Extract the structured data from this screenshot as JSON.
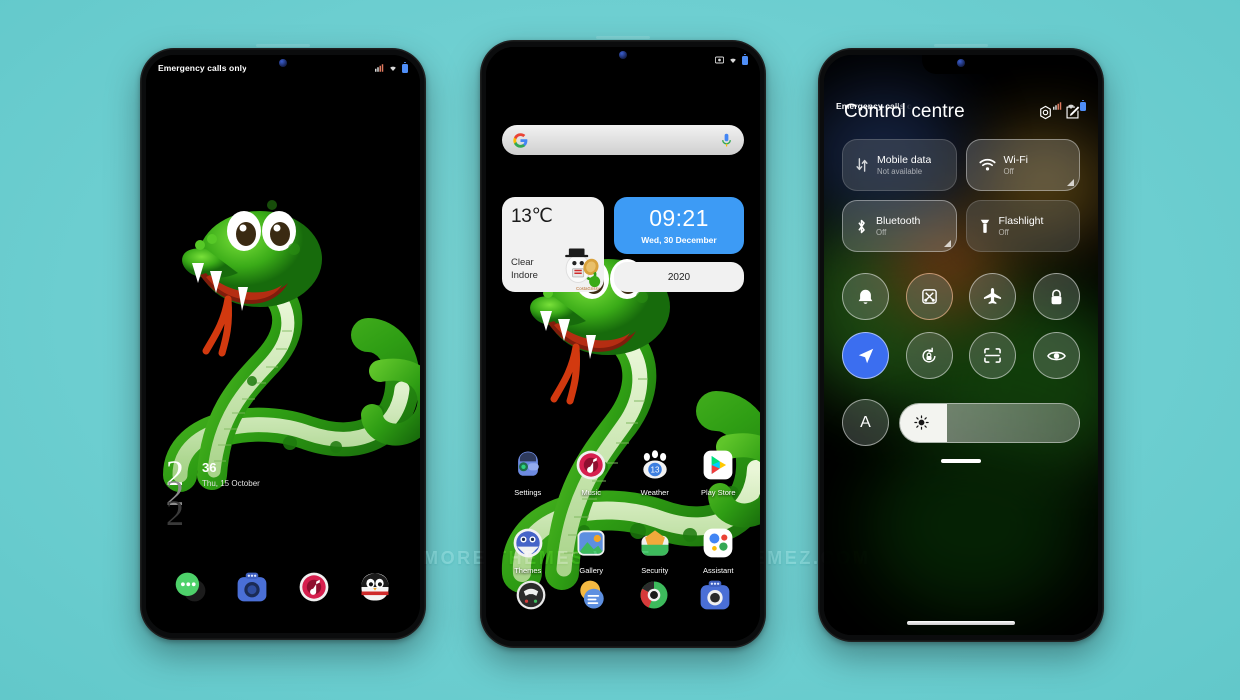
{
  "meta": {
    "background_color": "#6ecfd1",
    "watermark": "FOR MORE THEMES VISIT - MIUITHEMEZ.COM"
  },
  "phone1": {
    "statusbar": {
      "carrier": "Emergency calls only",
      "icons": [
        "signal-icon",
        "wifi-icon",
        "battery-icon"
      ]
    },
    "lockscreen": {
      "hour_stack": [
        "2",
        "2",
        "2"
      ],
      "minutes": "36",
      "date": "Thu, 15 October"
    },
    "dock": [
      {
        "name": "messaging",
        "label": "Messaging"
      },
      {
        "name": "camera",
        "label": "Camera"
      },
      {
        "name": "music",
        "label": "Music"
      },
      {
        "name": "penguin",
        "label": "Penguin"
      }
    ]
  },
  "phone2": {
    "statusbar": {
      "carrier": "",
      "icons": [
        "screenshot-icon",
        "wifi-icon",
        "battery-icon"
      ]
    },
    "search": {
      "placeholder": "",
      "left_icon": "google-g-icon",
      "right_icon": "microphone-icon"
    },
    "weather_widget": {
      "temperature": "13℃",
      "condition": "Clear",
      "city": "Indore",
      "mascot_name": "CostaGrissy"
    },
    "clock_widget": {
      "time": "09:21",
      "date": "Wed, 30 December",
      "year": "2020",
      "accent": "#3d9bf5"
    },
    "apps_row1": [
      {
        "name": "settings",
        "label": "Settings"
      },
      {
        "name": "music",
        "label": "Music"
      },
      {
        "name": "weather",
        "label": "Weather",
        "badge": "13"
      },
      {
        "name": "play-store",
        "label": "Play Store"
      }
    ],
    "apps_row2": [
      {
        "name": "themes",
        "label": "Themes"
      },
      {
        "name": "gallery",
        "label": "Gallery"
      },
      {
        "name": "security",
        "label": "Security"
      },
      {
        "name": "assistant",
        "label": "Assistant"
      }
    ],
    "dock": [
      {
        "name": "phone",
        "label": "Phone"
      },
      {
        "name": "messages",
        "label": "Messages"
      },
      {
        "name": "browser",
        "label": "Browser"
      },
      {
        "name": "camera",
        "label": "Camera"
      }
    ]
  },
  "phone3": {
    "statusbar": {
      "carrier": "Emergency calls o",
      "icons": [
        "signal-icon",
        "wifi-icon",
        "battery-icon"
      ]
    },
    "title": "Control centre",
    "actions": [
      {
        "name": "settings-gear-icon",
        "label": "Settings"
      },
      {
        "name": "edit-icon",
        "label": "Edit"
      }
    ],
    "tiles": [
      {
        "name": "mobile-data",
        "label": "Mobile data",
        "status": "Not available",
        "active": false,
        "expandable": false
      },
      {
        "name": "wifi",
        "label": "Wi-Fi",
        "status": "Off",
        "active": true,
        "expandable": true
      },
      {
        "name": "bluetooth",
        "label": "Bluetooth",
        "status": "Off",
        "active": true,
        "expandable": true
      },
      {
        "name": "flashlight",
        "label": "Flashlight",
        "status": "Off",
        "active": false,
        "expandable": false
      }
    ],
    "toggles_row1": [
      {
        "name": "silent-bell",
        "label": "Silent",
        "active": false
      },
      {
        "name": "cast",
        "label": "Cast",
        "active": false
      },
      {
        "name": "airplane-mode",
        "label": "Airplane mode",
        "active": false
      },
      {
        "name": "screen-lock",
        "label": "Lock",
        "active": false
      }
    ],
    "toggles_row2": [
      {
        "name": "location",
        "label": "Location",
        "active": true
      },
      {
        "name": "auto-rotate",
        "label": "Auto rotate",
        "active": false
      },
      {
        "name": "scanner",
        "label": "Scanner",
        "active": false
      },
      {
        "name": "reading-mode",
        "label": "Reading mode",
        "active": false
      }
    ],
    "brightness": {
      "auto_label": "A",
      "level_percent": 26
    }
  }
}
